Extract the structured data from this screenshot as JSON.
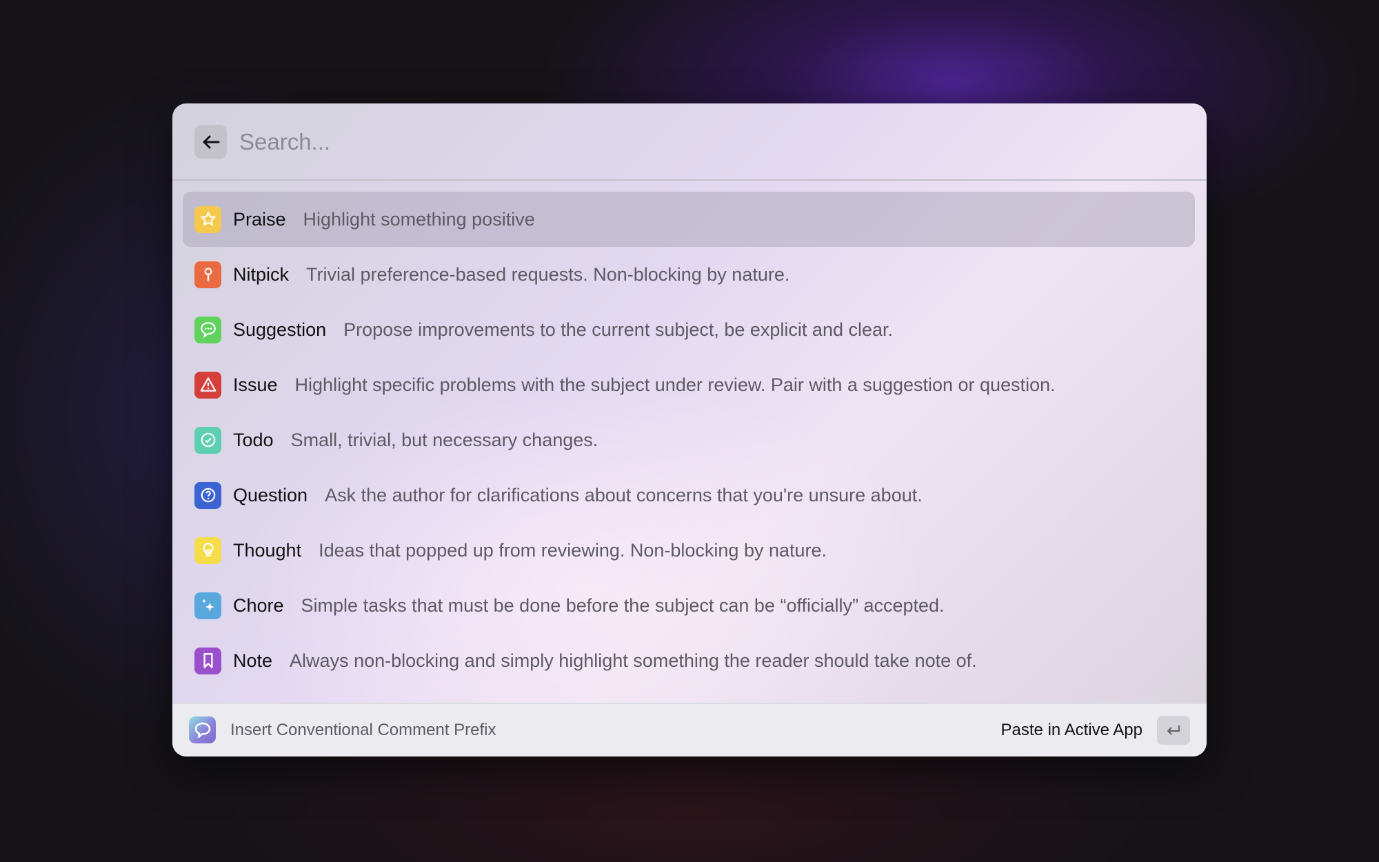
{
  "search": {
    "placeholder": "Search..."
  },
  "items": [
    {
      "label": "Praise",
      "description": "Highlight something positive",
      "icon": "star-icon",
      "color": "#f5c94c",
      "selected": true
    },
    {
      "label": "Nitpick",
      "description": "Trivial preference-based requests. Non-blocking by nature.",
      "icon": "pin-icon",
      "color": "#ec6a42"
    },
    {
      "label": "Suggestion",
      "description": "Propose improvements to the current subject, be explicit and clear.",
      "icon": "chat-bubble-icon",
      "color": "#62d25f"
    },
    {
      "label": "Issue",
      "description": "Highlight specific problems with the subject under review. Pair with a suggestion or question.",
      "icon": "warning-icon",
      "color": "#d43f3a"
    },
    {
      "label": "Todo",
      "description": "Small, trivial, but necessary changes.",
      "icon": "check-circle-icon",
      "color": "#5fcfb3"
    },
    {
      "label": "Question",
      "description": "Ask the author for clarifications about concerns that you're unsure about.",
      "icon": "question-circle-icon",
      "color": "#3b63d1"
    },
    {
      "label": "Thought",
      "description": "Ideas that popped up from reviewing. Non-blocking by nature.",
      "icon": "lightbulb-icon",
      "color": "#f4dd48"
    },
    {
      "label": "Chore",
      "description": "Simple tasks that must be done before the subject can be “officially” accepted.",
      "icon": "sparkles-icon",
      "color": "#58a8dd"
    },
    {
      "label": "Note",
      "description": "Always non-blocking and simply highlight something the reader should take note of.",
      "icon": "bookmark-icon",
      "color": "#9a4fcb"
    }
  ],
  "footer": {
    "title": "Insert Conventional Comment Prefix",
    "action": "Paste in Active App"
  }
}
